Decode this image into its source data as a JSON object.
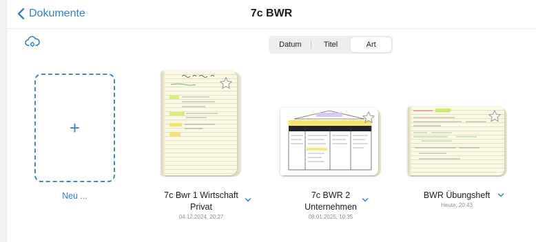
{
  "nav": {
    "back_label": "Dokumente",
    "title": "7c BWR"
  },
  "sort": {
    "options": [
      "Datum",
      "Titel",
      "Art"
    ],
    "selected": "Art"
  },
  "new_item": {
    "plus": "+",
    "label": "Neu ..."
  },
  "documents": [
    {
      "title_line1": "7c Bwr 1 Wirtschaft",
      "title_line2": "Privat",
      "date": "04.12.2024, 20:27"
    },
    {
      "title_line1": "7c BWR 2",
      "title_line2": "Unternehmen",
      "date": "08.01.2025, 10:35"
    },
    {
      "title_line1": "BWR Übungsheft",
      "date": "Heute, 20:43"
    }
  ],
  "colors": {
    "accent": "#2f7fd6",
    "paper": "#fbf8e4",
    "highlight_green": "#c8ec5a",
    "highlight_yellow": "#f6e15a"
  }
}
